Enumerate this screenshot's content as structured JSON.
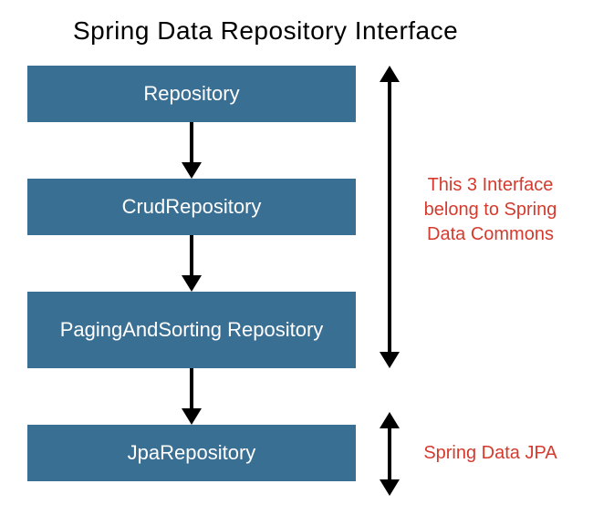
{
  "title": "Spring Data Repository Interface",
  "boxes": {
    "b1": "Repository",
    "b2": "CrudRepository",
    "b3": "PagingAndSorting Repository",
    "b4": "JpaRepository"
  },
  "annotations": {
    "group1": "This 3 Interface belong to Spring Data Commons",
    "group2": "Spring Data JPA"
  }
}
